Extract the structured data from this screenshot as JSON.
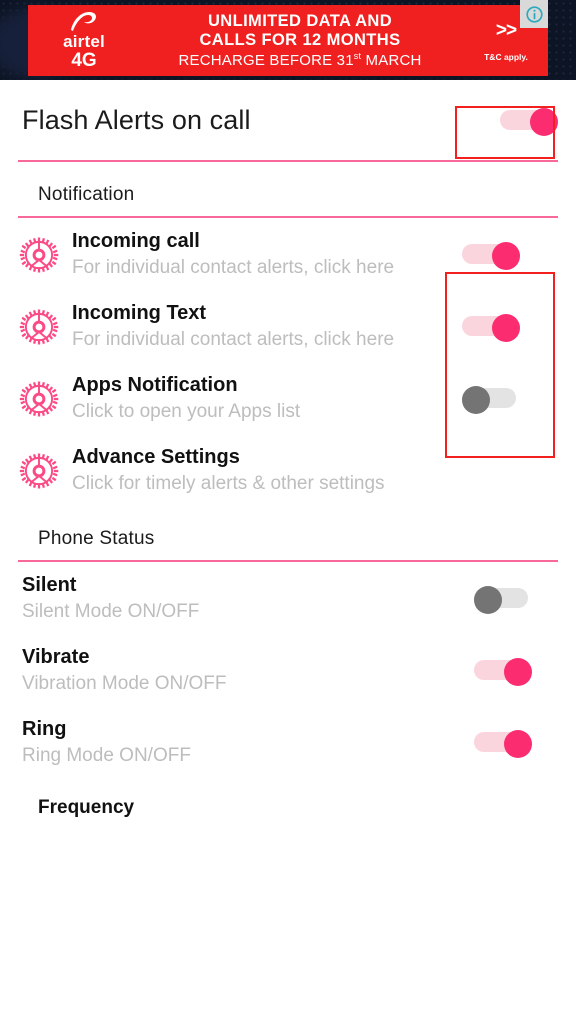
{
  "ad": {
    "brand": "airtel",
    "network": "4G",
    "line1": "UNLIMITED DATA AND",
    "line2": "CALLS FOR 12 MONTHS",
    "line3_pre": "RECHARGE BEFORE 31",
    "line3_sup": "st",
    "line3_post": " MARCH",
    "arrows": ">>",
    "terms": "T&C apply.",
    "info_icon": "info-circle-icon",
    "bg_color": "#f02020",
    "page_bg": "#0d1524"
  },
  "header": {
    "title": "Flash Alerts on call",
    "toggle_state": "on"
  },
  "sections": [
    {
      "heading": "Notification",
      "items": [
        {
          "icon": "gear-icon",
          "title": "Incoming call",
          "subtitle": "For individual contact alerts, click here",
          "toggle_state": "on"
        },
        {
          "icon": "gear-icon",
          "title": "Incoming Text",
          "subtitle": "For individual contact alerts, click here",
          "toggle_state": "on"
        },
        {
          "icon": "gear-icon",
          "title": "Apps Notification",
          "subtitle": "Click to open your Apps list",
          "toggle_state": "off"
        },
        {
          "icon": "gear-icon",
          "title": "Advance Settings",
          "subtitle": "Click for timely alerts & other settings",
          "toggle_state": "none"
        }
      ]
    },
    {
      "heading": "Phone Status",
      "items": [
        {
          "title": "Silent",
          "subtitle": "Silent Mode ON/OFF",
          "toggle_state": "off"
        },
        {
          "title": "Vibrate",
          "subtitle": "Vibration Mode ON/OFF",
          "toggle_state": "on"
        },
        {
          "title": "Ring",
          "subtitle": "Ring Mode ON/OFF",
          "toggle_state": "on"
        }
      ]
    }
  ],
  "partial_bottom": {
    "heading": "Frequency"
  },
  "colors": {
    "accent_pink": "#fb2c70",
    "track_pink": "#fbd5de",
    "divider_pink": "#f9689a",
    "toggle_off_thumb": "#747474",
    "toggle_off_track": "#e3e3e3",
    "highlight_red": "#f32020",
    "subtitle_gray": "#bdbdbd",
    "ad_red": "#f02020",
    "info_teal": "#2aa9bf"
  }
}
